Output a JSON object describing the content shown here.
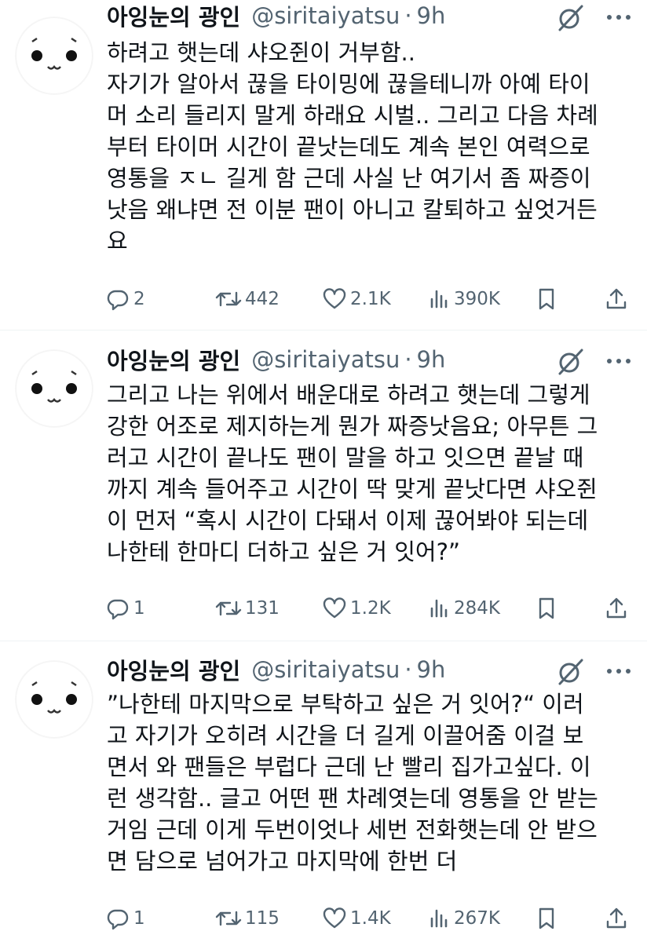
{
  "tweets": [
    {
      "author": {
        "name": "아잉눈의 광인",
        "handle": "@siritaiyatsu",
        "dot": "·",
        "time": "9h"
      },
      "lines": [
        "하려고 햇는데 샤오쥔이 거부함..",
        "자기가 알아서 끊을 타이밍에 끊을테니까 아예 타이",
        "머 소리 들리지 말게 하래요 시벌.. 그리고 다음 차례",
        "부터 타이머 시간이 끝낫는데도 계속 본인 여력으로",
        "영통을 ㅈㄴ 길게 함 근데 사실 난 여기서 좀 짜증이",
        "낫음 왜냐면 전 이분 팬이 아니고 칼퇴하고 싶엇거든",
        "요"
      ],
      "stats": {
        "replies": "2",
        "retweets": "442",
        "likes": "2.1K",
        "views": "390K"
      }
    },
    {
      "author": {
        "name": "아잉눈의 광인",
        "handle": "@siritaiyatsu",
        "dot": "·",
        "time": "9h"
      },
      "lines": [
        "그리고 나는 위에서 배운대로 하려고 햇는데 그렇게",
        "강한 어조로 제지하는게 뭔가 짜증낫음요; 아무튼 그",
        "러고 시간이 끝나도 팬이 말을 하고 잇으면 끝날 때",
        "까지 계속 들어주고 시간이 딱 맞게 끝낫다면 샤오쥔",
        "이 먼저 “혹시 시간이 다돼서 이제 끊어봐야 되는데",
        "나한테 한마디 더하고 싶은 거 잇어?”"
      ],
      "stats": {
        "replies": "1",
        "retweets": "131",
        "likes": "1.2K",
        "views": "284K"
      }
    },
    {
      "author": {
        "name": "아잉눈의 광인",
        "handle": "@siritaiyatsu",
        "dot": "·",
        "time": "9h"
      },
      "lines": [
        "”나한테 마지막으로 부탁하고 싶은 거 잇어?“ 이러",
        "고 자기가 오히려 시간을 더 길게 이끌어줌 이걸 보",
        "면서 와 팬들은 부럽다 근데 난 빨리 집가고싶다. 이",
        "런 생각함.. 글고 어떤 팬 차례엿는데 영통을 안 받는",
        "거임 근데 이게 두번이엇나 세번 전화햇는데 안 받으",
        "면 담으로 넘어가고 마지막에 한번 더"
      ],
      "stats": {
        "replies": "1",
        "retweets": "115",
        "likes": "1.4K",
        "views": "267K"
      }
    }
  ],
  "icons": {
    "reply": "reply-icon",
    "retweet": "retweet-icon",
    "like": "heart-icon",
    "views": "views-chart-icon",
    "bookmark": "bookmark-icon",
    "share": "share-icon",
    "grok": "grok-slash-icon",
    "more": "more-dots-icon"
  },
  "colors": {
    "text": "#0f1419",
    "secondary": "#536471",
    "divider": "#eff3f4"
  }
}
